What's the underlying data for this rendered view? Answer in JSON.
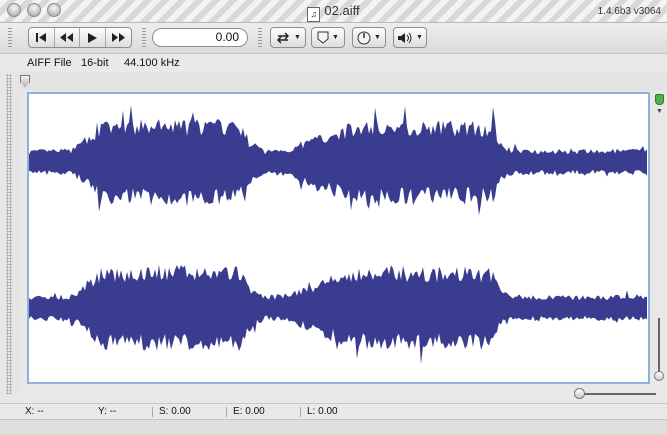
{
  "window": {
    "title": "02.aiff",
    "version": "1.4.6b3 v3064"
  },
  "toolbar": {
    "transport_icons": [
      "skip-to-start-icon",
      "rewind-icon",
      "play-icon",
      "fast-forward-icon"
    ],
    "time_value": "0.00",
    "loop_icon": "loop-icon",
    "marker_icon": "marker-icon",
    "gain_icon": "knob-icon",
    "volume_icon": "speaker-icon"
  },
  "file_info": {
    "format": "AIFF File",
    "bit_depth": "16-bit",
    "sample_rate": "44.100 kHz"
  },
  "status": {
    "x": "X: --",
    "y": "Y: --",
    "s": "S: 0.00",
    "e": "E: 0.00",
    "l": "L: 0.00"
  },
  "colors": {
    "waveform": "#3a3d8f",
    "selection_border": "#8cb1dc",
    "marker_green": "#4fb24f"
  }
}
